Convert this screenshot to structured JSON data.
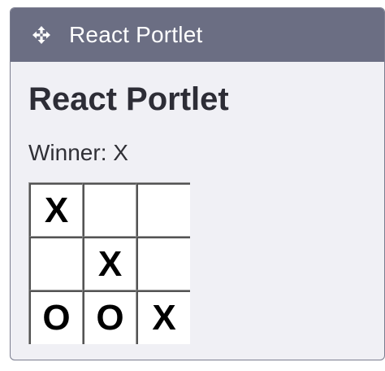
{
  "portlet": {
    "topbar_title": "React Portlet",
    "icon": "move-icon"
  },
  "content": {
    "heading": "React Portlet",
    "status": "Winner: X"
  },
  "board": {
    "squares": [
      "X",
      "",
      "",
      "",
      "X",
      "",
      "O",
      "O",
      "X"
    ]
  }
}
